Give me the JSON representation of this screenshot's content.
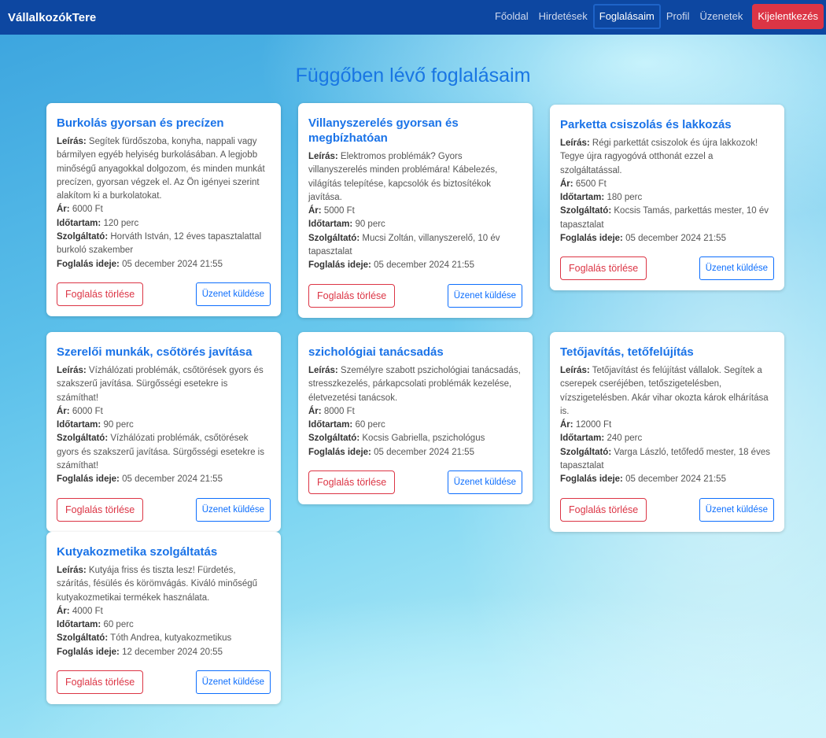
{
  "brand": "VállalkozókTere",
  "nav": {
    "home": "Főoldal",
    "ads": "Hirdetések",
    "bookings": "Foglalásaim",
    "profile": "Profil",
    "messages": "Üzenetek",
    "logout": "Kijelentkezés"
  },
  "page_title": "Függőben lévő foglalásaim",
  "labels": {
    "desc": "Leírás:",
    "price": "Ár:",
    "duration": "Időtartam:",
    "provider": "Szolgáltató:",
    "booked": "Foglalás ideje:",
    "delete_button": "Foglalás törlése",
    "message_button": "Üzenet küldése"
  },
  "bookings": [
    {
      "title": "Burkolás gyorsan és precízen",
      "desc": "Segítek fürdőszoba, konyha, nappali vagy bármilyen egyéb helyiség burkolásában. A legjobb minőségű anyagokkal dolgozom, és minden munkát precízen, gyorsan végzek el. Az Ön igényei szerint alakítom ki a burkolatokat.",
      "price": "6000 Ft",
      "duration": "120 perc",
      "provider": "Horváth István, 12 éves tapasztalattal burkoló szakember",
      "booked": "05 december 2024 21:55"
    },
    {
      "title": "Villanyszerelés gyorsan és megbízhatóan",
      "desc": "Elektromos problémák? Gyors villanyszerelés minden problémára! Kábelezés, világítás telepítése, kapcsolók és biztosítékok javítása.",
      "price": "5000 Ft",
      "duration": "90 perc",
      "provider": "Mucsi Zoltán, villanyszerelő, 10 év tapasztalat",
      "booked": "05 december 2024 21:55"
    },
    {
      "title": "Parketta csiszolás és lakkozás",
      "desc": "Régi parkettát csiszolok és újra lakkozok! Tegye újra ragyogóvá otthonát ezzel a szolgáltatással.",
      "price": "6500 Ft",
      "duration": "180 perc",
      "provider": "Kocsis Tamás, parkettás mester, 10 év tapasztalat",
      "booked": "05 december 2024 21:55"
    },
    {
      "title": "Szerelői munkák, csőtörés javítása",
      "desc": "Vízhálózati problémák, csőtörések gyors és szakszerű javítása. Sürgősségi esetekre is számíthat!",
      "price": "6000 Ft",
      "duration": "90 perc",
      "provider": "Vízhálózati problémák, csőtörések gyors és szakszerű javítása. Sürgősségi esetekre is számíthat!",
      "booked": "05 december 2024 21:55"
    },
    {
      "title": "szichológiai tanácsadás",
      "desc": "Személyre szabott pszichológiai tanácsadás, stresszkezelés, párkapcsolati problémák kezelése, életvezetési tanácsok.",
      "price": "8000 Ft",
      "duration": "60 perc",
      "provider": "Kocsis Gabriella, pszichológus",
      "booked": "05 december 2024 21:55"
    },
    {
      "title": "Tetőjavítás, tetőfelújítás",
      "desc": "Tetőjavítást és felújítást vállalok. Segítek a cserepek cseréjében, tetőszigetelésben, vízszigetelésben. Akár vihar okozta károk elhárítása is.",
      "price": "12000 Ft",
      "duration": "240 perc",
      "provider": "Varga László, tetőfedő mester, 18 éves tapasztalat",
      "booked": "05 december 2024 21:55"
    },
    {
      "title": "Kutyakozmetika szolgáltatás",
      "desc": "Kutyája friss és tiszta lesz! Fürdetés, szárítás, fésülés és körömvágás. Kiváló minőségű kutyakozmetikai termékek használata.",
      "price": "4000 Ft",
      "duration": "60 perc",
      "provider": "Tóth Andrea, kutyakozmetikus",
      "booked": "12 december 2024 20:55"
    }
  ]
}
